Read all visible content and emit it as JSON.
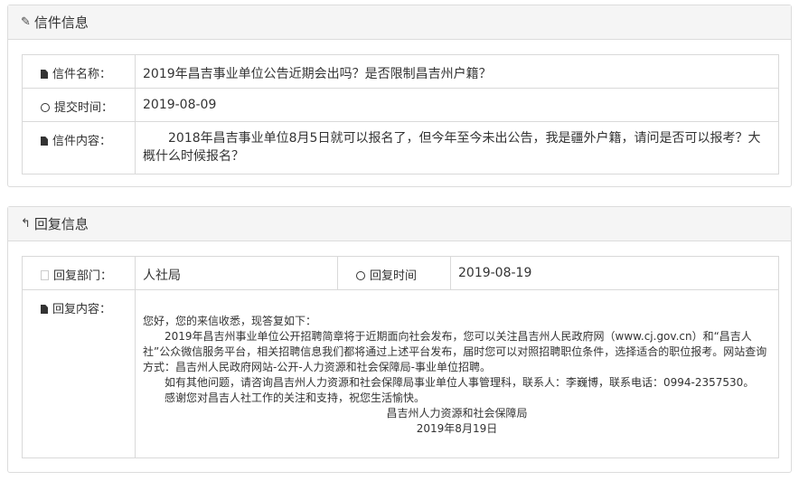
{
  "letter_panel": {
    "title": "信件信息",
    "rows": {
      "name_label": "信件名称：",
      "name_value": "2019年昌吉事业单位公告近期会出吗？是否限制昌吉州户籍？",
      "date_label": "提交时间：",
      "date_value": "2019-08-09",
      "content_label": "信件内容：",
      "content_value": "2018年昌吉事业单位8月5日就可以报名了，但今年至今未出公告，我是疆外户籍，请问是否可以报考？大概什么时候报名？"
    }
  },
  "reply_panel": {
    "title": "回复信息",
    "dept_label": "回复部门：",
    "dept_value": "人社局",
    "time_label": "回复时间",
    "time_value": "2019-08-19",
    "content_label": "回复内容：",
    "content": {
      "greeting": "您好，您的来信收悉，现答复如下：",
      "para1": "2019年昌吉州事业单位公开招聘简章将于近期面向社会发布，您可以关注昌吉州人民政府网（www.cj.gov.cn）和“昌吉人社”公众微信服务平台，相关招聘信息我们都将通过上述平台发布，届时您可以对照招聘职位条件，选择适合的职位报考。网站查询方式：昌吉州人民政府网站-公开-人力资源和社会保障局-事业单位招聘。",
      "para2": "如有其他问题，请咨询昌吉州人力资源和社会保障局事业单位人事管理科，联系人：李巍博，联系电话：0994-2357530。",
      "para3": "感谢您对昌吉人社工作的关注和支持，祝您生活愉快。",
      "sign_org": "昌吉州人力资源和社会保障局",
      "sign_date": "2019年8月19日"
    }
  },
  "icons": {
    "letter_title_icon": "paperclip-icon",
    "reply_title_icon": "reply-icon"
  }
}
